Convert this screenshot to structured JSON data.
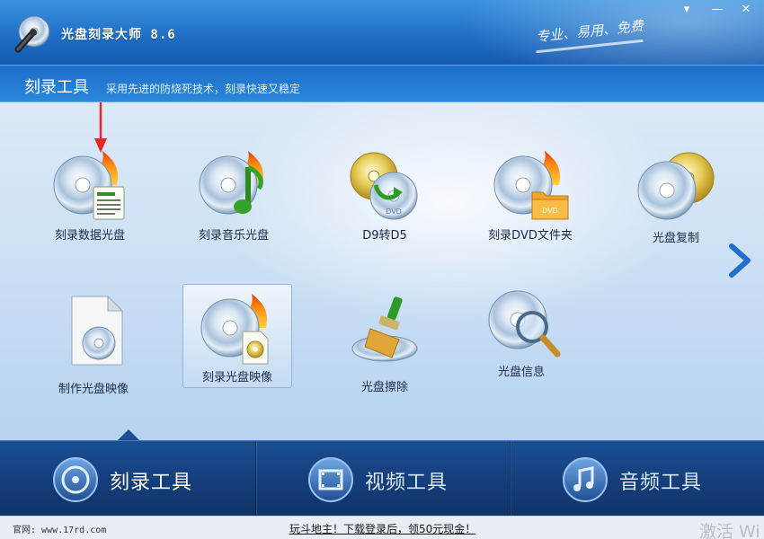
{
  "app": {
    "title": "光盘刻录大师 8.6",
    "slogan": "专业、易用、免费",
    "window_controls": {
      "menu": "▾",
      "minimize": "—",
      "close": "✕"
    }
  },
  "section": {
    "title": "刻录工具",
    "description": "采用先进的防烧死技术，刻录快速又稳定"
  },
  "tools": [
    {
      "id": "burn-data-disc",
      "label": "刻录数据光盘",
      "icon": "data-disc-fire-icon"
    },
    {
      "id": "burn-music-disc",
      "label": "刻录音乐光盘",
      "icon": "music-disc-fire-icon"
    },
    {
      "id": "d9-to-d5",
      "label": "D9转D5",
      "icon": "disc-convert-icon"
    },
    {
      "id": "burn-dvd-folder",
      "label": "刻录DVD文件夹",
      "icon": "dvd-folder-fire-icon"
    },
    {
      "id": "copy-disc",
      "label": "光盘复制",
      "icon": "disc-copy-icon"
    },
    {
      "id": "make-disc-image",
      "label": "制作光盘映像",
      "icon": "disc-image-file-icon"
    },
    {
      "id": "burn-disc-image",
      "label": "刻录光盘映像",
      "icon": "disc-image-fire-icon",
      "selected": true
    },
    {
      "id": "erase-disc",
      "label": "光盘擦除",
      "icon": "disc-brush-icon"
    },
    {
      "id": "disc-info",
      "label": "光盘信息",
      "icon": "disc-magnifier-icon"
    }
  ],
  "tabs": [
    {
      "label": "刻录工具",
      "icon": "disc-icon",
      "active": true
    },
    {
      "label": "视频工具",
      "icon": "film-icon",
      "active": false
    },
    {
      "label": "音频工具",
      "icon": "music-note-icon",
      "active": false
    }
  ],
  "status": {
    "website": "官网: www.17rd.com",
    "promo": "玩斗地主！下载登录后，领50元现金！",
    "watermark": "激活 Wi"
  },
  "colors": {
    "title_bar": "#1f6fc6",
    "tab_bar": "#153f7d",
    "content_bg": "#cfe2f6",
    "annotation_arrow": "#e8262a"
  }
}
